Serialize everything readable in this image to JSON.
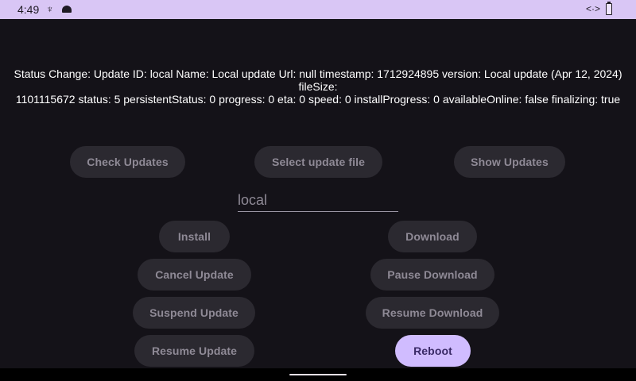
{
  "status_bar": {
    "time": "4:49",
    "icons": [
      "usb-icon",
      "android-icon",
      "code-icon",
      "battery-icon"
    ]
  },
  "status_message": {
    "line1": "Status Change: Update ID: local Name: Local update Url: null timestamp: 1712924895 version: Local update (Apr 12, 2024) fileSize:",
    "line2": "1101115672 status: 5 persistentStatus: 0 progress: 0 eta: 0 speed: 0 installProgress: 0 availableOnline: false finalizing: true"
  },
  "buttons": {
    "check_updates": "Check Updates",
    "select_update_file": "Select update file",
    "show_updates": "Show Updates",
    "install": "Install",
    "download": "Download",
    "cancel_update": "Cancel Update",
    "pause_download": "Pause Download",
    "suspend_update": "Suspend Update",
    "resume_download": "Resume Download",
    "resume_update": "Resume Update",
    "reboot": "Reboot"
  },
  "update_id_input": {
    "value": "local"
  },
  "colors": {
    "status_bar_bg": "#d9c6f5",
    "screen_bg": "#141218",
    "button_bg": "#2b2930",
    "primary_button_bg": "#d0bcff"
  }
}
